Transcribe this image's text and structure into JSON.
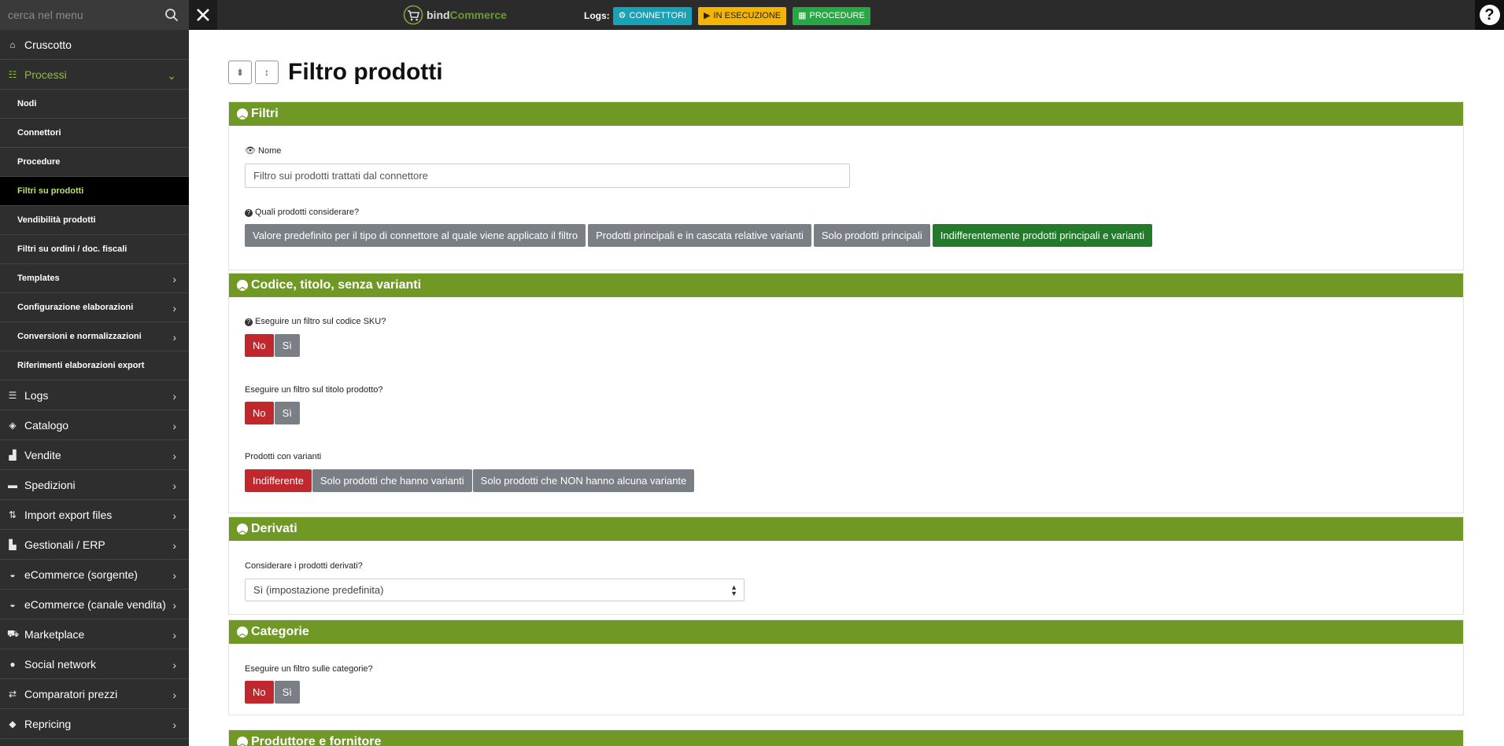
{
  "topbar": {
    "search_placeholder": "cerca nel menu",
    "brand_prefix": "bind",
    "brand_suffix": "Commerce",
    "logs_label": "Logs:",
    "log_buttons": [
      {
        "label": "CONNETTORI",
        "icon": "gear-icon",
        "color": "#17a2b8"
      },
      {
        "label": "IN ESECUZIONE",
        "icon": "play-icon",
        "color": "#f5b400"
      },
      {
        "label": "PROCEDURE",
        "icon": "calendar-icon",
        "color": "#28a745"
      }
    ],
    "help_symbol": "?"
  },
  "sidebar": {
    "items": [
      {
        "label": "Cruscotto",
        "icon": "home-icon"
      },
      {
        "label": "Processi",
        "icon": "process-icon",
        "expanded": true
      },
      {
        "label": "Nodi"
      },
      {
        "label": "Connettori"
      },
      {
        "label": "Procedure"
      },
      {
        "label": "Filtri su prodotti",
        "current": true
      },
      {
        "label": "Vendibilità prodotti"
      },
      {
        "label": "Filtri su ordini / doc. fiscali"
      },
      {
        "label": "Templates"
      },
      {
        "label": "Configurazione elaborazioni"
      },
      {
        "label": "Conversioni e normalizzazioni"
      },
      {
        "label": "Riferimenti elaborazioni export"
      },
      {
        "label": "Logs",
        "icon": "list-icon"
      },
      {
        "label": "Catalogo",
        "icon": "cube-icon"
      },
      {
        "label": "Vendite",
        "icon": "chart-icon"
      },
      {
        "label": "Spedizioni",
        "icon": "truck-icon"
      },
      {
        "label": "Import export files",
        "icon": "sort-icon"
      },
      {
        "label": "Gestionali / ERP",
        "icon": "building-icon"
      },
      {
        "label": "eCommerce (sorgente)",
        "icon": "basket-icon"
      },
      {
        "label": "eCommerce (canale vendita)",
        "icon": "basket-icon"
      },
      {
        "label": "Marketplace",
        "icon": "cart-icon"
      },
      {
        "label": "Social network",
        "icon": "users-icon"
      },
      {
        "label": "Comparatori prezzi",
        "icon": "compare-icon"
      },
      {
        "label": "Repricing",
        "icon": "tag-icon"
      }
    ]
  },
  "page": {
    "title": "Filtro prodotti",
    "panels": {
      "filtri": {
        "title": "Filtri",
        "name_label": "Nome",
        "name_value": "Filtro sui prodotti trattati dal connettore",
        "which_label": "Quali prodotti considerare?",
        "which_options": [
          "Valore predefinito per il tipo di connettore al quale viene applicato il filtro",
          "Prodotti principali e in cascata relative varianti",
          "Solo prodotti principali",
          "Indifferentemente prodotti principali e varianti"
        ],
        "which_selected": 3
      },
      "codice": {
        "title": "Codice, titolo, senza varianti",
        "sku_label": "Eseguire un filtro sul codice SKU?",
        "sku_options": [
          "No",
          "Sì"
        ],
        "title_filter_label": "Eseguire un filtro sul titolo prodotto?",
        "title_filter_options": [
          "No",
          "Sì"
        ],
        "variants_label": "Prodotti con varianti",
        "variants_options": [
          "Indifferente",
          "Solo prodotti che hanno varianti",
          "Solo prodotti che NON hanno alcuna variante"
        ]
      },
      "derivati": {
        "title": "Derivati",
        "label": "Considerare i prodotti derivati?",
        "selected": "Sì (impostazione predefinita)"
      },
      "categorie": {
        "title": "Categorie",
        "label": "Eseguire un filtro sulle categorie?",
        "options": [
          "No",
          "Sì"
        ]
      },
      "produttore": {
        "title": "Produttore e fornitore"
      }
    }
  },
  "colors": {
    "panel_header": "#6f9824",
    "sidebar_bg": "#2e2e2e",
    "selected_green": "#237a2b",
    "selected_red": "#c0282d",
    "option_grey": "#7a7f85"
  }
}
